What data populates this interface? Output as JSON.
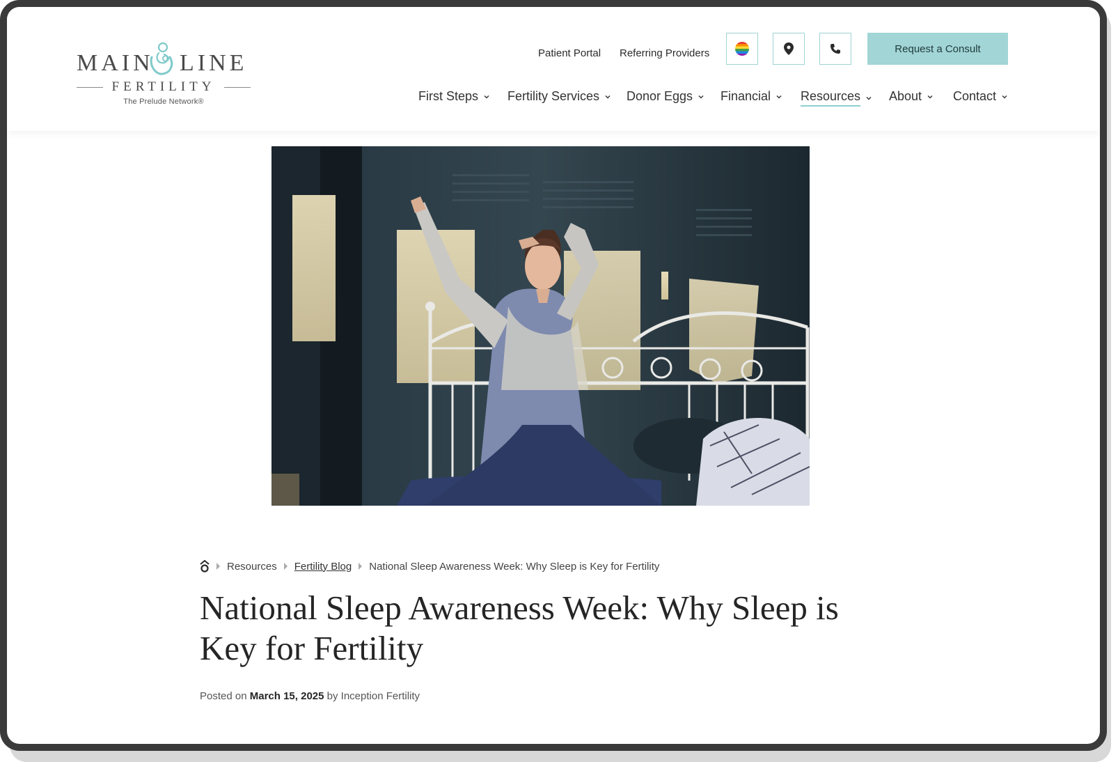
{
  "logo": {
    "main_word1": "MAIN",
    "main_word2": "LINE",
    "fertility": "FERTILITY",
    "tagline": "The Prelude Network®"
  },
  "utility_nav": {
    "patient_portal": "Patient Portal",
    "referring_providers": "Referring Providers",
    "consult_button": "Request a Consult",
    "icons": [
      "pride-rainbow-icon",
      "location-pin-icon",
      "phone-icon"
    ]
  },
  "main_nav": [
    {
      "label": "First Steps"
    },
    {
      "label": "Fertility Services"
    },
    {
      "label": "Donor Eggs"
    },
    {
      "label": "Financial"
    },
    {
      "label": "Resources",
      "active": true
    },
    {
      "label": "About"
    },
    {
      "label": "Contact"
    }
  ],
  "breadcrumb": {
    "home_icon": "home-icon",
    "items": [
      "Resources",
      "Fertility Blog",
      "National Sleep Awareness Week: Why Sleep is Key for Fertility"
    ]
  },
  "article": {
    "title": "National Sleep Awareness Week: Why Sleep is Key for Fertility",
    "posted_prefix": "Posted on",
    "date": "March 15, 2025",
    "by": "by",
    "author": "Inception Fertility"
  },
  "colors": {
    "accent": "#a2d5d6",
    "accent_border": "#9fd3d3",
    "text": "#2b2b2b"
  }
}
